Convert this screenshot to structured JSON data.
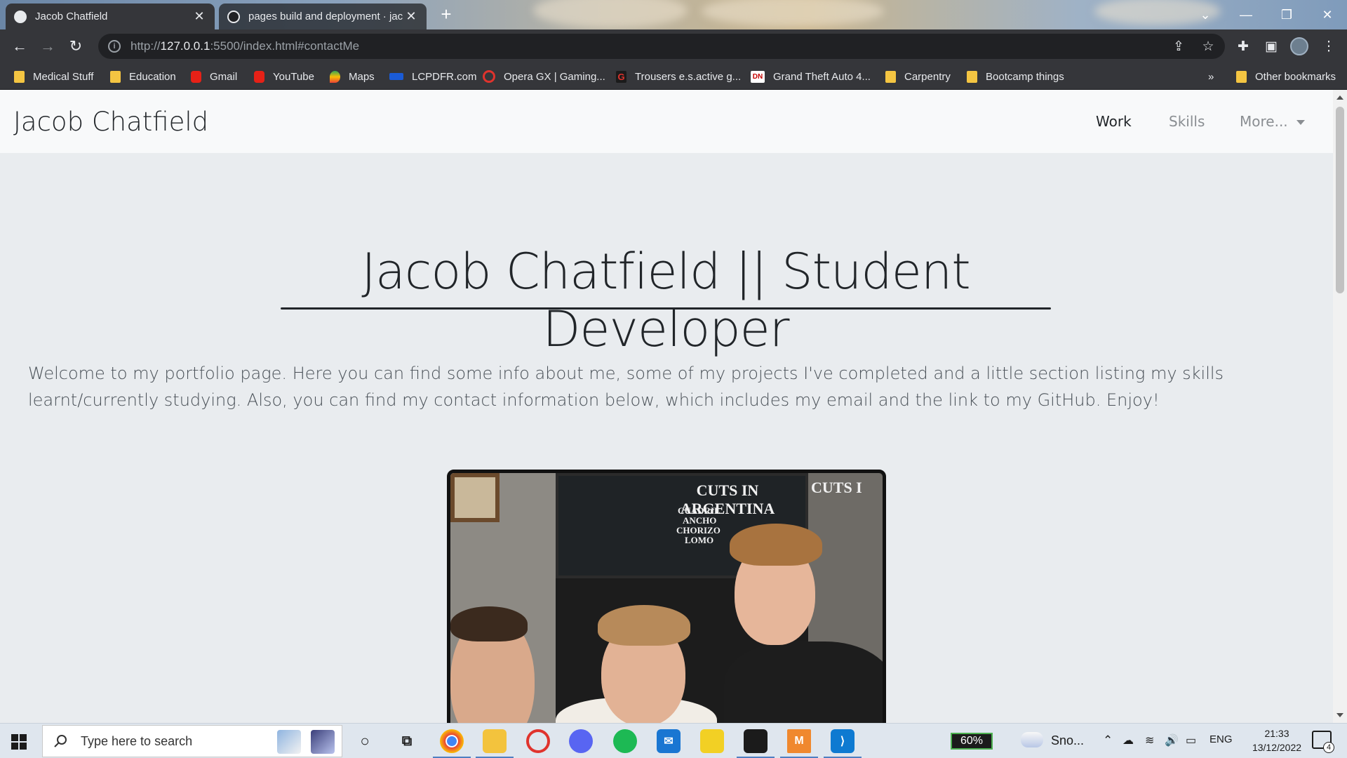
{
  "browser": {
    "tabs": [
      {
        "title": "Jacob Chatfield",
        "active": true
      },
      {
        "title": "pages build and deployment · jac",
        "active": false
      }
    ],
    "new_tab_symbol": "+",
    "url": {
      "scheme": "http://",
      "host": "127.0.0.1",
      "rest": ":5500/index.html#contactMe"
    },
    "bookmarks": [
      {
        "label": "Medical Stuff",
        "icon": "folder-icon"
      },
      {
        "label": "Education",
        "icon": "folder-icon"
      },
      {
        "label": "Gmail",
        "icon": "youtube-icon"
      },
      {
        "label": "YouTube",
        "icon": "youtube-icon"
      },
      {
        "label": "Maps",
        "icon": "maps-icon"
      },
      {
        "label": "LCPDFR.com",
        "icon": "lcpdfr-icon"
      },
      {
        "label": "Opera GX | Gaming...",
        "icon": "opera-icon"
      },
      {
        "label": "Trousers e.s.active g...",
        "icon": "g-icon"
      },
      {
        "label": "Grand Theft Auto 4...",
        "icon": "gta-icon"
      },
      {
        "label": "Carpentry",
        "icon": "folder-icon"
      },
      {
        "label": "Bootcamp things",
        "icon": "folder-icon"
      }
    ],
    "bookmarks_overflow": "»",
    "other_bookmarks": "Other bookmarks"
  },
  "site": {
    "brand": "Jacob Chatfield",
    "nav": [
      {
        "label": "Work",
        "active": true
      },
      {
        "label": "Skills",
        "active": false
      },
      {
        "label": "More...",
        "active": false,
        "dropdown": true
      }
    ],
    "hero_title": "Jacob Chatfield || Student Developer",
    "intro": "Welcome to my portfolio page. Here you can find some info about me, some of my projects I've completed and a little section listing my skills learnt/currently studying. Also, you can find my contact information below, which includes my email and the link to my GitHub. Enjoy!",
    "photo": {
      "board_heading": "CUTS IN ARGENTINA",
      "board_items": [
        "CUADRIL",
        "ANCHO",
        "CHORIZO",
        "LOMO"
      ],
      "board_heading_2": "CUTS I"
    }
  },
  "taskbar": {
    "search_placeholder": "Type here to search",
    "battery_widget": "60%",
    "weather": "Sno...",
    "language": "ENG",
    "time": "21:33",
    "date": "13/12/2022",
    "notifications": "4"
  },
  "colors": {
    "chrome_dark": "#35363a",
    "page_bg": "#e9ecef",
    "navbar_bg": "#f8f9fa",
    "text_dark": "#212529",
    "text_muted": "#495057"
  }
}
